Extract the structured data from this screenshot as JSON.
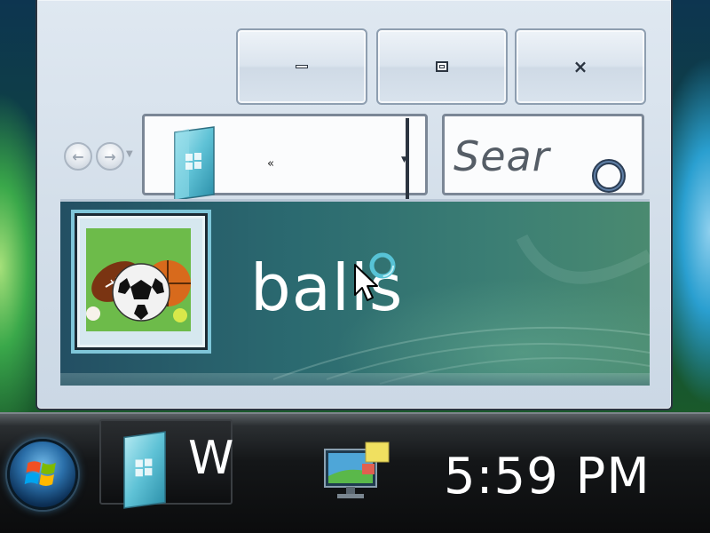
{
  "window": {
    "caption_buttons": {
      "minimize_icon": "minimize-icon",
      "maximize_icon": "maximize-icon",
      "close_glyph": "×"
    },
    "nav": {
      "back_icon": "back-arrow-icon",
      "forward_icon": "forward-arrow-icon"
    },
    "address_bar": {
      "breadcrumb": "«"
    },
    "search_box": {
      "placeholder": "Sear"
    },
    "header": {
      "title": "balls",
      "thumbnail_icon": "sports-balls-icon"
    }
  },
  "taskbar": {
    "start_icon": "windows-start-orb-icon",
    "task_button_label": "W",
    "tray_icon": "network-monitor-icon",
    "clock": "5:59 PM"
  },
  "colors": {
    "banner_start": "#234f63",
    "banner_end": "#4a8a70",
    "thumbnail_background": "#6dbb4a",
    "taskbar": "#141618"
  }
}
